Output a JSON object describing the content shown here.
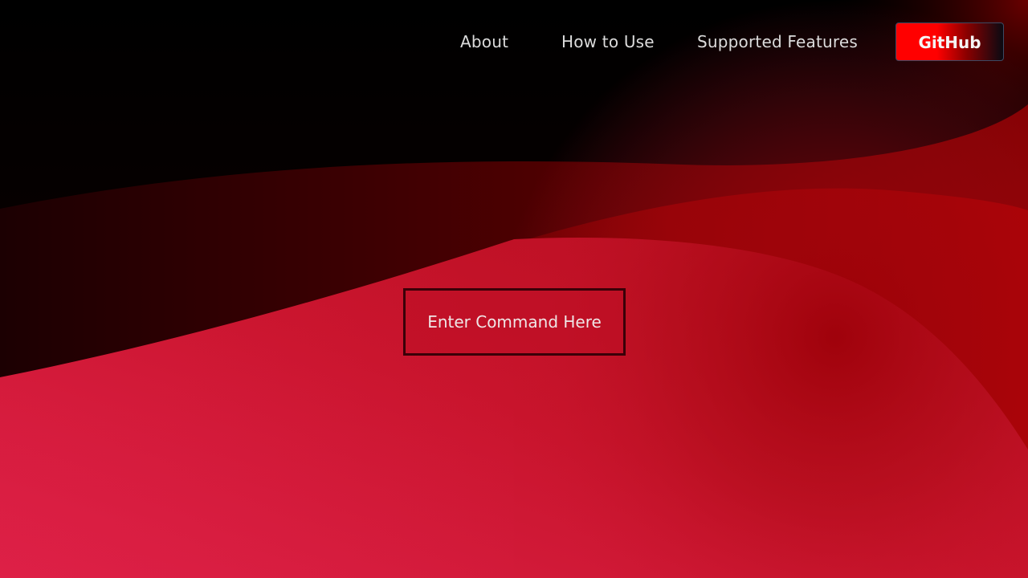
{
  "nav": {
    "about": "About",
    "how_to_use": "How to Use",
    "supported_features": "Supported Features",
    "github": "GitHub"
  },
  "main": {
    "command_button": "Enter Command Here"
  },
  "colors": {
    "primary_red": "#d81e40",
    "dark_bg": "#000000",
    "github_red": "#ff0000"
  }
}
